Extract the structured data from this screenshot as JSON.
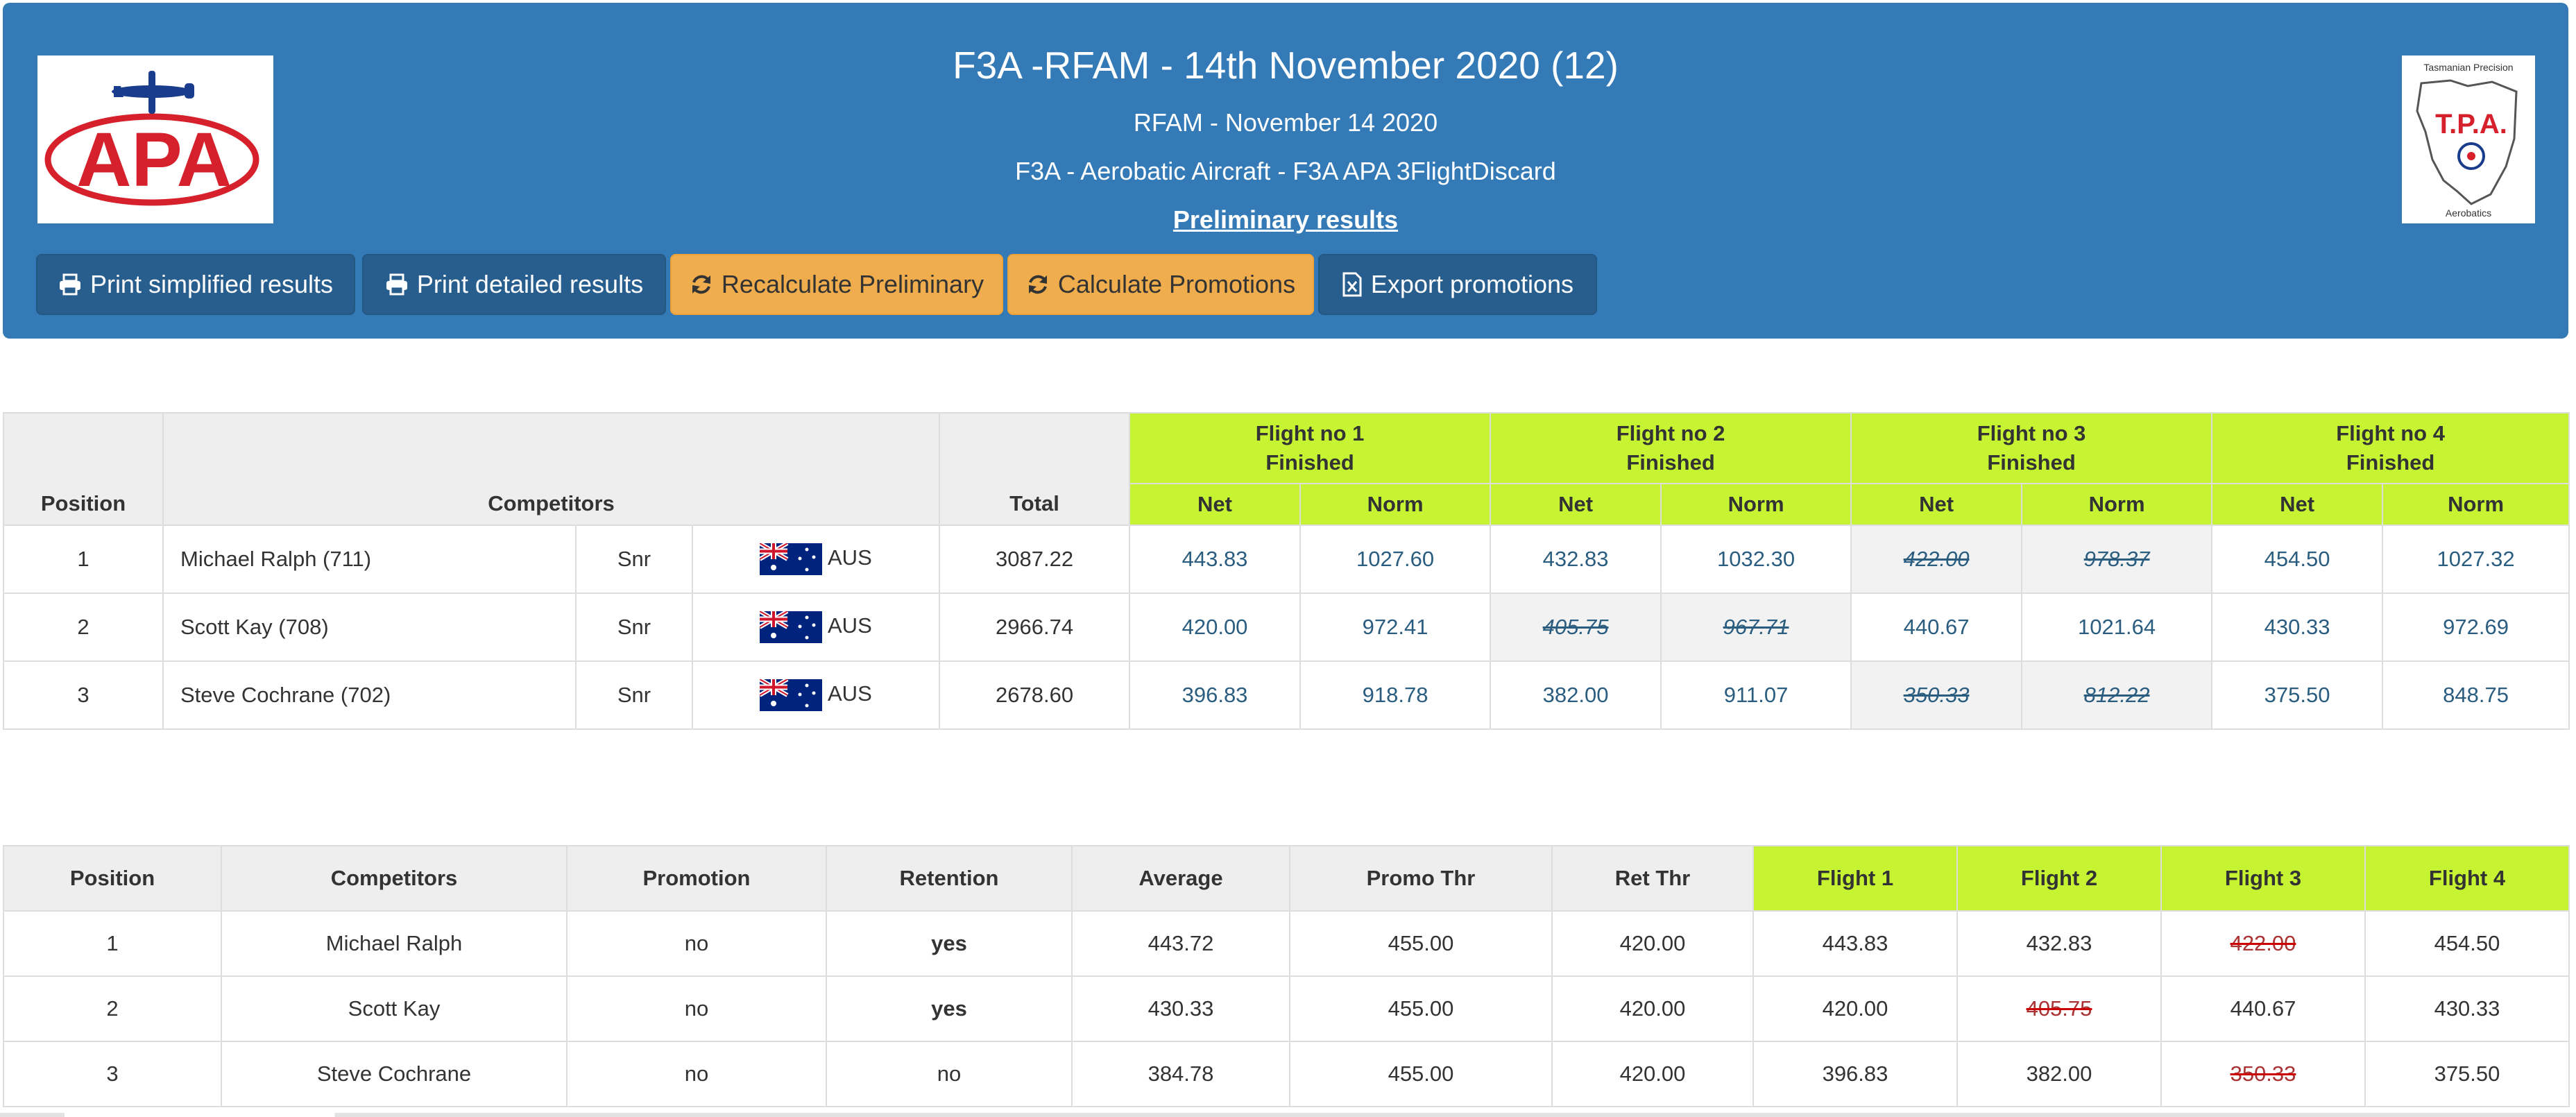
{
  "header": {
    "title": "F3A -RFAM - 14th November 2020 (12)",
    "subtitle": "RFAM - November 14 2020",
    "class_line": "F3A - Aerobatic Aircraft - F3A APA 3FlightDiscard",
    "status_link": "Preliminary results",
    "left_logo_text": "APA",
    "right_logo": {
      "top": "Tasmanian Precision",
      "mid": "T.P.A.",
      "bottom": "Aerobatics"
    }
  },
  "buttons": [
    {
      "label": "Print simplified results",
      "icon": "printer-icon"
    },
    {
      "label": "Print detailed results",
      "icon": "printer-icon"
    },
    {
      "label": "Recalculate Preliminary",
      "icon": "refresh-icon"
    },
    {
      "label": "Calculate Promotions",
      "icon": "refresh-icon"
    },
    {
      "label": "Export promotions",
      "icon": "excel-file-icon"
    }
  ],
  "colors": {
    "header_bg": "#337ab7",
    "dark_button": "#285e8e",
    "warning_button": "#f0ad4e",
    "flight_header": "#c6f432",
    "link": "#2a5d7f"
  },
  "results": {
    "headers": {
      "position": "Position",
      "competitors": "Competitors",
      "total": "Total",
      "net": "Net",
      "norm": "Norm"
    },
    "flights": [
      {
        "name": "Flight no 1",
        "status": "Finished"
      },
      {
        "name": "Flight no 2",
        "status": "Finished"
      },
      {
        "name": "Flight no 3",
        "status": "Finished"
      },
      {
        "name": "Flight no 4",
        "status": "Finished"
      }
    ],
    "rows": [
      {
        "position": "1",
        "name": "Michael Ralph (711)",
        "class": "Snr",
        "country": "AUS",
        "total": "3087.22",
        "scores": [
          "443.83",
          "1027.60",
          "432.83",
          "1032.30",
          "422.00",
          "978.37",
          "454.50",
          "1027.32"
        ]
      },
      {
        "position": "2",
        "name": "Scott Kay (708)",
        "class": "Snr",
        "country": "AUS",
        "total": "2966.74",
        "scores": [
          "420.00",
          "972.41",
          "405.75",
          "967.71",
          "440.67",
          "1021.64",
          "430.33",
          "972.69"
        ]
      },
      {
        "position": "3",
        "name": "Steve Cochrane (702)",
        "class": "Snr",
        "country": "AUS",
        "total": "2678.60",
        "scores": [
          "396.83",
          "918.78",
          "382.00",
          "911.07",
          "350.33",
          "812.22",
          "375.50",
          "848.75"
        ]
      }
    ]
  },
  "promotions": {
    "headers": [
      "Position",
      "Competitors",
      "Promotion",
      "Retention",
      "Average",
      "Promo Thr",
      "Ret Thr",
      "Flight 1",
      "Flight 2",
      "Flight 3",
      "Flight 4"
    ],
    "rows": [
      {
        "position": "1",
        "name": "Michael Ralph",
        "promotion": "no",
        "retention": "yes",
        "average": "443.72",
        "promo_thr": "455.00",
        "ret_thr": "420.00",
        "flights": [
          "443.83",
          "432.83",
          "422.00",
          "454.50"
        ]
      },
      {
        "position": "2",
        "name": "Scott Kay",
        "promotion": "no",
        "retention": "yes",
        "average": "430.33",
        "promo_thr": "455.00",
        "ret_thr": "420.00",
        "flights": [
          "420.00",
          "405.75",
          "440.67",
          "430.33"
        ]
      },
      {
        "position": "3",
        "name": "Steve Cochrane",
        "promotion": "no",
        "retention": "no",
        "average": "384.78",
        "promo_thr": "455.00",
        "ret_thr": "420.00",
        "flights": [
          "396.83",
          "382.00",
          "350.33",
          "375.50"
        ]
      }
    ]
  }
}
